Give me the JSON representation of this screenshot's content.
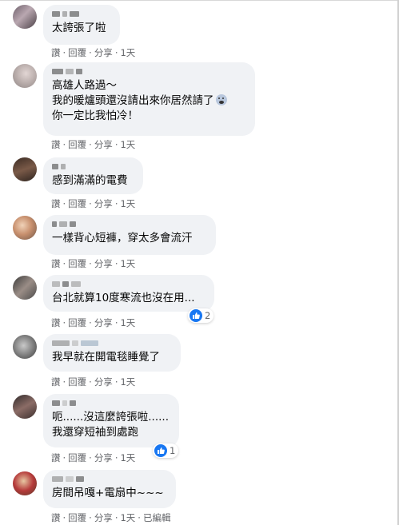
{
  "actions": {
    "like": "讚",
    "reply": "回覆",
    "share": "分享",
    "sep": "·",
    "edited": "已編輯"
  },
  "comments": [
    {
      "lines": [
        "太誇張了啦"
      ],
      "time": "1天"
    },
    {
      "lines": [
        "高雄人路過～",
        "我的暖爐頭還沒請出來你居然請了",
        "你一定比我怕冷！"
      ],
      "emoji": "scared-face-emoji",
      "time": "1天"
    },
    {
      "lines": [
        "感到滿滿的電費"
      ],
      "time": "1天"
    },
    {
      "lines": [
        "一樣背心短褲，穿太多會流汗"
      ],
      "time": "1天"
    },
    {
      "lines": [
        "台北就算10度寒流也沒在用..."
      ],
      "time": "1天",
      "likes": "2"
    },
    {
      "lines": [
        "我早就在開電毯睡覺了"
      ],
      "time": "1天"
    },
    {
      "lines": [
        "呃......沒這麼誇張啦......",
        "我還穿短袖到處跑"
      ],
      "time": "1天",
      "likes": "1"
    },
    {
      "lines": [
        "房間吊嘎+電扇中~~~"
      ],
      "time": "1天"
    }
  ],
  "colors": {
    "bubble": "#f0f2f5",
    "meta": "#65676b",
    "like": "#1877f2"
  }
}
